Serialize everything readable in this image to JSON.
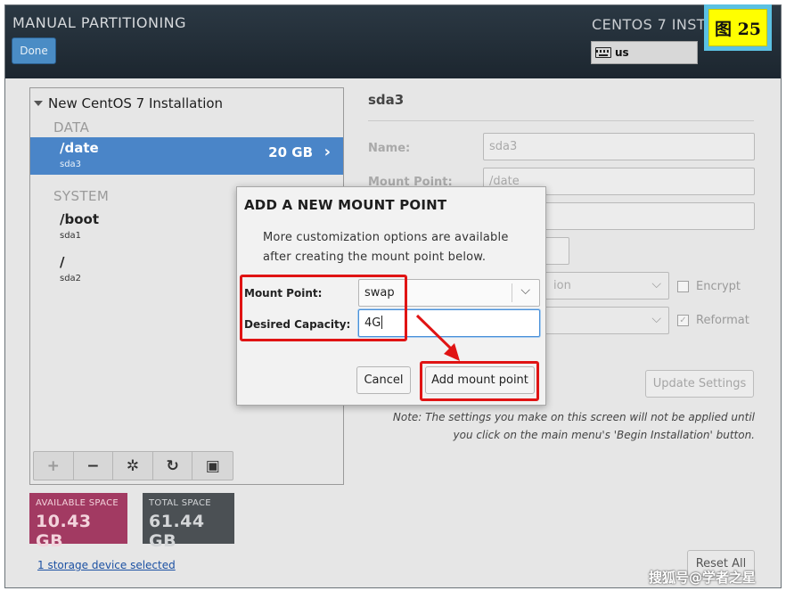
{
  "header": {
    "title": "MANUAL PARTITIONING",
    "done_label": "Done",
    "product": "CENTOS 7 INSTA",
    "keyboard_layout": "us",
    "figure_label": "图 25"
  },
  "left_panel": {
    "root_label": "New CentOS 7 Installation",
    "groups": {
      "data": "DATA",
      "system": "SYSTEM"
    },
    "items": [
      {
        "mount": "/date",
        "device": "sda3",
        "size": "20 GB",
        "selected": true
      },
      {
        "mount": "/boot",
        "device": "sda1"
      },
      {
        "mount": "/",
        "device": "sda2"
      }
    ],
    "toolbar": [
      "+",
      "−",
      "✲",
      "↻",
      "▣"
    ]
  },
  "space": {
    "available_label": "AVAILABLE SPACE",
    "available_value": "10.43 GB",
    "total_label": "TOTAL SPACE",
    "total_value": "61.44 GB"
  },
  "storage_link": "1 storage device selected",
  "right_panel": {
    "device_title": "sda3",
    "name_label": "Name:",
    "name_value": "sda3",
    "mount_point_label": "Mount Point:",
    "mount_point_value": "/date",
    "device_type_partial": "ion",
    "encrypt_label": "Encrypt",
    "reformat_label": "Reformat",
    "update_settings": "Update Settings",
    "note": "Note:  The settings you make on this screen will not be applied until you click on the main menu's 'Begin Installation' button.",
    "reset_all": "Reset All"
  },
  "dialog": {
    "title": "ADD A NEW MOUNT POINT",
    "description": "More customization options are available after creating the mount point below.",
    "mount_point_label": "Mount Point:",
    "mount_point_value": "swap",
    "capacity_label": "Desired Capacity:",
    "capacity_value": "4G",
    "cancel_label": "Cancel",
    "add_label": "Add mount point"
  },
  "watermark": "搜狐号@学者之星",
  "colors": {
    "header_bg": "#1c262f",
    "selection": "#4a85c8",
    "available_space": "#a23a62",
    "total_space": "#4b5054",
    "annotation_red": "#e01414",
    "figure_badge": "#ffff00"
  }
}
